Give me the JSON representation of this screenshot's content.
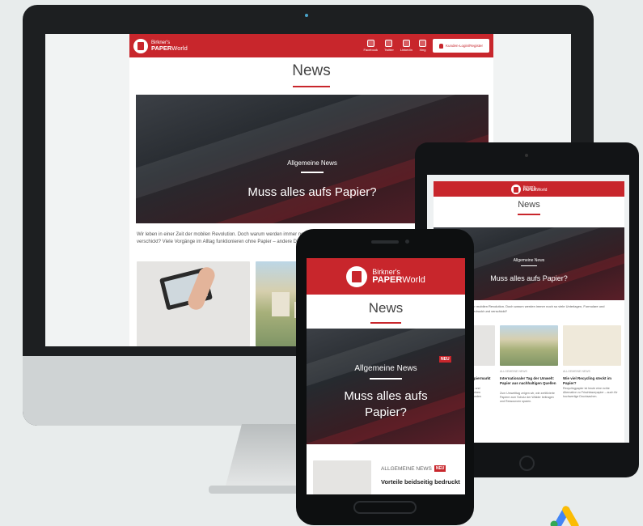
{
  "brand": {
    "line1": "Birkner's",
    "line2_bold": "PAPER",
    "line2_light": "World",
    "color": "#c8262c"
  },
  "nav": {
    "items": [
      {
        "label": "Facebook",
        "icon": "facebook-icon"
      },
      {
        "label": "Twitter",
        "icon": "twitter-icon"
      },
      {
        "label": "LinkedIn",
        "icon": "linkedin-icon"
      },
      {
        "label": "Xing",
        "icon": "xing-icon"
      }
    ],
    "login_label": "Kunden-Login/Register"
  },
  "page": {
    "title": "News"
  },
  "hero": {
    "category": "Allgemeine News",
    "title": "Muss alles aufs Papier?",
    "badge": "NEU"
  },
  "desktop": {
    "intro": "Wir leben in einer Zeit der mobilen Revolution. Doch warum werden immer noch so viele Unterlagen, Formulare und Dokumente auf Papier gedruckt und verschickt? Viele Vorgänge im Alltag funktionieren ohne Papier – andere Dinge im Papier weiterhin unverzichtbar."
  },
  "tablet": {
    "intro": "Wir leben in einer Zeit der mobilen Revolution. Doch warum werden immer noch so viele Unterlagen, Formulare und Dokumente auf Papier gedruckt und verschickt?",
    "cards": [
      {
        "meta": "ALLGEMEINE NEWS",
        "title": "Veränderungen im Papiermarkt",
        "text": "Wie sich der Markt für Druck- und Büropapiere in den letzten Jahren verändert hat und was auf Kunden zukommt."
      },
      {
        "meta": "ALLGEMEINE NEWS",
        "title": "Internationaler Tag der Umwelt: Papier aus nachhaltigen Quellen",
        "text": "Zum Umwelttag zeigen wir, wie zertifizierte Papiere zum Schutz der Wälder beitragen und Ressourcen sparen."
      },
      {
        "meta": "ALLGEMEINE NEWS",
        "title": "Wie viel Recycling steckt im Papier?",
        "text": "Recyclingpapier ist heute eine echte Alternative zu Frischfaserpapier – auch für hochwertige Drucksachen."
      }
    ]
  },
  "phone": {
    "card": {
      "meta": "ALLGEMEINE NEWS",
      "badge": "NEU",
      "title": "Vorteile beidseitig bedruckt"
    }
  }
}
